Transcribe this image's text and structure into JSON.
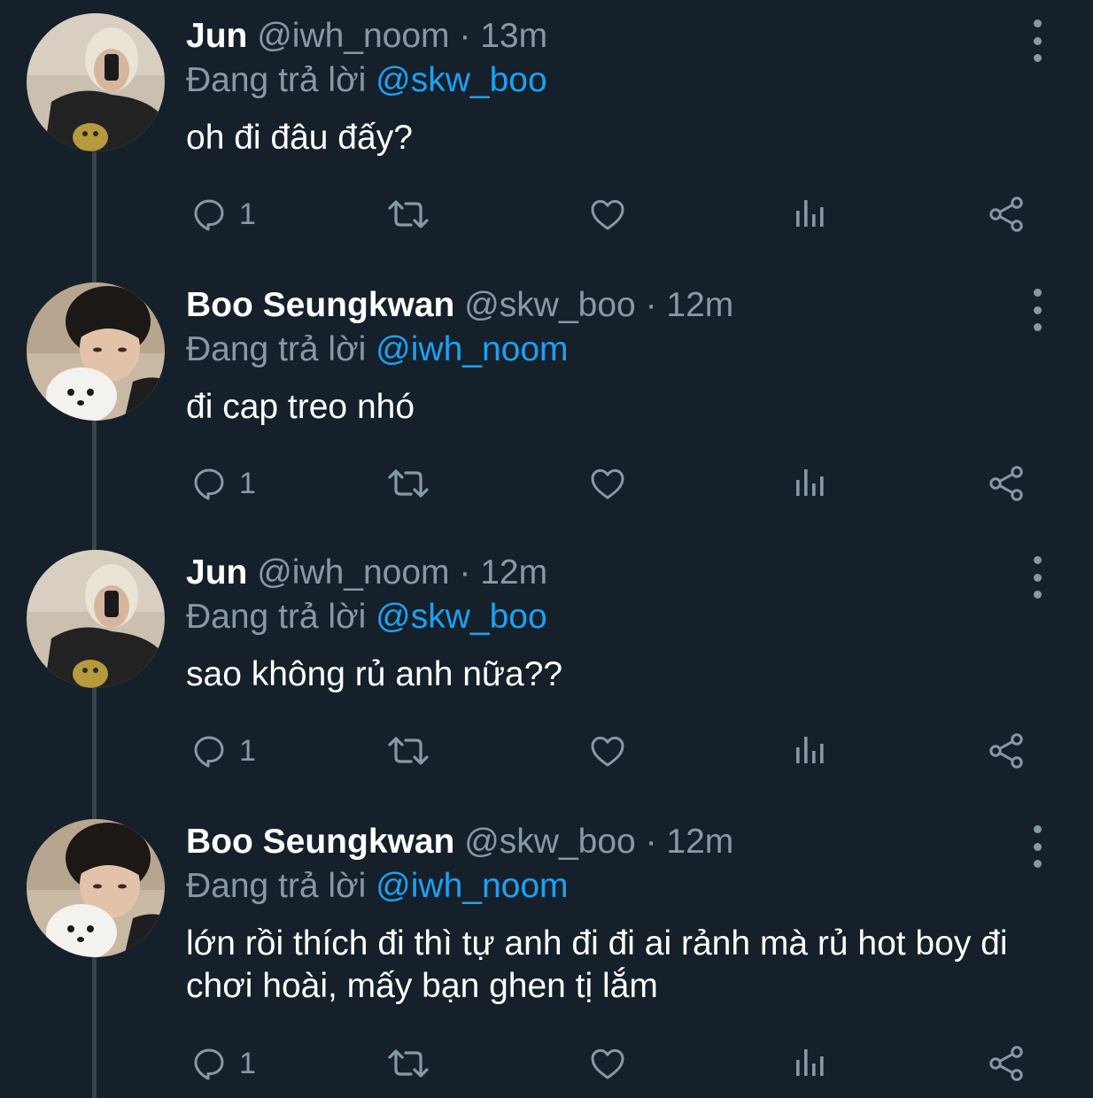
{
  "tweets": [
    {
      "display_name": "Jun",
      "handle": "@iwh_noom",
      "separator": "·",
      "time": "13m",
      "reply_prefix": "Đang trả lời",
      "reply_to": "@skw_boo",
      "text": "oh đi đâu đấy?",
      "reply_count": "1",
      "avatar": "avatar-jun"
    },
    {
      "display_name": "Boo Seungkwan",
      "handle": "@skw_boo",
      "separator": "·",
      "time": "12m",
      "reply_prefix": "Đang trả lời",
      "reply_to": "@iwh_noom",
      "text": "đi cap treo nhó",
      "reply_count": "1",
      "avatar": "avatar-boo"
    },
    {
      "display_name": "Jun",
      "handle": "@iwh_noom",
      "separator": "·",
      "time": "12m",
      "reply_prefix": "Đang trả lời",
      "reply_to": "@skw_boo",
      "text": "sao không rủ anh nữa??",
      "reply_count": "1",
      "avatar": "avatar-jun"
    },
    {
      "display_name": "Boo Seungkwan",
      "handle": "@skw_boo",
      "separator": "·",
      "time": "12m",
      "reply_prefix": "Đang trả lời",
      "reply_to": "@iwh_noom",
      "text": "lớn rồi thích đi thì tự anh đi đi ai rảnh mà rủ hot boy đi chơi hoài, mấy bạn ghen tị lắm",
      "reply_count": "1",
      "avatar": "avatar-boo"
    }
  ],
  "icons": {
    "reply": "reply-icon",
    "retweet": "retweet-icon",
    "like": "heart-icon",
    "analytics": "analytics-icon",
    "share": "share-icon",
    "more": "more-vertical-icon"
  },
  "colors": {
    "background": "#15202b",
    "primary_text": "#ffffff",
    "secondary_text": "#8899a6",
    "accent": "#1da1f2",
    "thread_line": "#38444d"
  }
}
